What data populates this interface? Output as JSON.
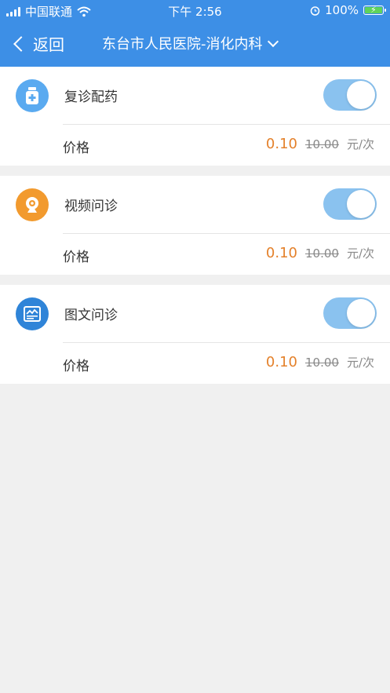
{
  "status": {
    "carrier": "中国联通",
    "time": "下午 2:56",
    "battery": "100%"
  },
  "nav": {
    "back_label": "返回",
    "title": "东台市人民医院-消化内科"
  },
  "colors": {
    "primary": "#3d8fe6",
    "price": "#e4812b",
    "toggle_on": "#8ac2ef"
  },
  "services": [
    {
      "name": "复诊配药",
      "icon": "medicine-bottle-icon",
      "icon_color": "#5aaaf0",
      "enabled": true,
      "price_label": "价格",
      "price": "0.10",
      "original_price": "10.00",
      "unit": "元/次"
    },
    {
      "name": "视频问诊",
      "icon": "video-camera-icon",
      "icon_color": "#f29a2e",
      "enabled": true,
      "price_label": "价格",
      "price": "0.10",
      "original_price": "10.00",
      "unit": "元/次"
    },
    {
      "name": "图文问诊",
      "icon": "image-text-icon",
      "icon_color": "#2f84d8",
      "enabled": true,
      "price_label": "价格",
      "price": "0.10",
      "original_price": "10.00",
      "unit": "元/次"
    }
  ]
}
